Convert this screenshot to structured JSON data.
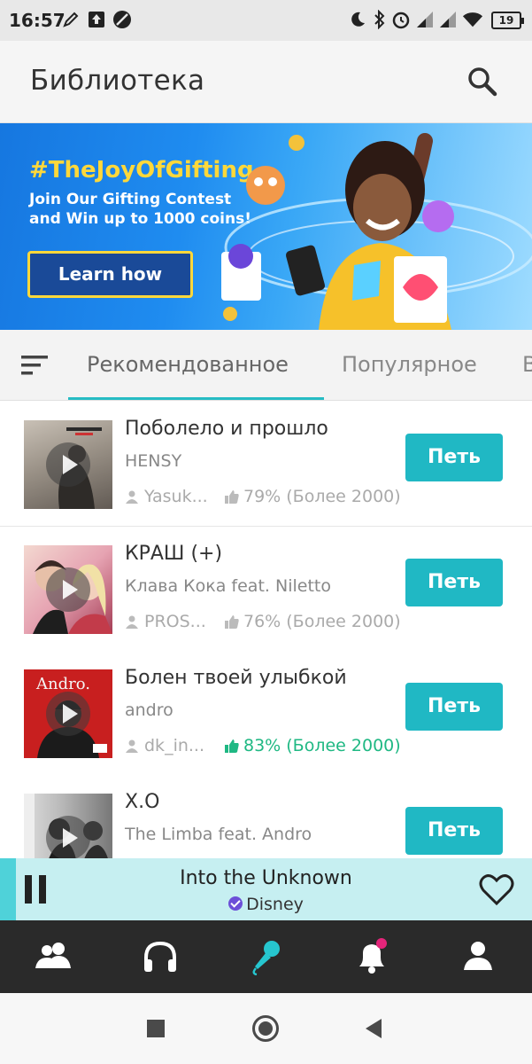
{
  "status_bar": {
    "time": "16:57",
    "battery": "19",
    "icons": [
      "pen-icon",
      "upload-icon",
      "no-sim-icon",
      "moon-icon",
      "bluetooth-icon",
      "alarm-icon",
      "signal-icon",
      "signal-icon",
      "wifi-icon",
      "battery-icon"
    ]
  },
  "app_bar": {
    "title": "Библиотека",
    "search_icon": "search-icon"
  },
  "banner": {
    "hashtag": "#TheJoyOfGifting",
    "line1": "Join Our Gifting Contest",
    "line2": "and Win up to 1000 coins!",
    "button": "Learn how",
    "colors": {
      "background": "#1f8cf0",
      "accent": "#ffd83a",
      "button_bg": "#1a4a98"
    }
  },
  "tabs": {
    "filter_icon": "sort-icon",
    "items": [
      "Рекомендованное",
      "Популярное",
      "В"
    ],
    "active_index": 0,
    "accent": "#26bcc4"
  },
  "songs": [
    {
      "title": "Поболело и прошло",
      "artist": "HENSY",
      "user": "Yasuk...",
      "rating": "79% (Более 2000)",
      "button": "Петь",
      "rating_highlight": false
    },
    {
      "title": "КРАШ (+)",
      "artist": "Клава Кока feat. Niletto",
      "user": "PROS...",
      "rating": "76% (Более 2000)",
      "button": "Петь",
      "rating_highlight": false
    },
    {
      "title": "Болен твоей улыбкой",
      "artist": "andro",
      "user": "dk_in...",
      "rating": "83% (Более 2000)",
      "button": "Петь",
      "rating_highlight": true
    },
    {
      "title": "X.O",
      "artist": "The Limba feat. Andro",
      "user": "",
      "rating": "",
      "button": "Петь",
      "rating_highlight": false
    }
  ],
  "cover_texts": {
    "andro": "Andro."
  },
  "player": {
    "title": "Into the Unknown",
    "artist": "Disney",
    "state": "playing",
    "icons": [
      "pause-icon",
      "verified-icon",
      "heart-icon"
    ]
  },
  "bottom_nav": {
    "items": [
      "people-icon",
      "headphones-icon",
      "microphone-icon",
      "bell-icon",
      "profile-icon"
    ],
    "active_index": 2,
    "notification_dot_index": 3
  },
  "system_nav": [
    "recents-icon",
    "home-icon",
    "back-icon"
  ]
}
